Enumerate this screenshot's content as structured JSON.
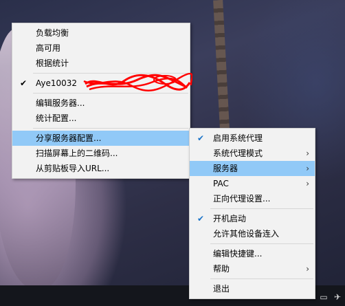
{
  "left_menu": {
    "items": [
      {
        "label": "负载均衡"
      },
      {
        "label": "高可用"
      },
      {
        "label": "根据统计"
      },
      {
        "label": "Aye10032",
        "checked": true,
        "redacted": true
      },
      {
        "label": "编辑服务器..."
      },
      {
        "label": "统计配置..."
      },
      {
        "label": "分享服务器配置...",
        "highlighted": true
      },
      {
        "label": "扫描屏幕上的二维码..."
      },
      {
        "label": "从剪贴板导入URL..."
      }
    ]
  },
  "tray_menu": {
    "items": [
      {
        "label": "启用系统代理",
        "checked": true
      },
      {
        "label": "系统代理模式",
        "submenu": true
      },
      {
        "label": "服务器",
        "submenu": true,
        "highlighted": true
      },
      {
        "label": "PAC",
        "submenu": true
      },
      {
        "label": "正向代理设置..."
      },
      {
        "label": "开机启动",
        "checked": true
      },
      {
        "label": "允许其他设备连入"
      },
      {
        "label": "编辑快捷键..."
      },
      {
        "label": "帮助",
        "submenu": true
      },
      {
        "label": "退出"
      }
    ]
  },
  "glyphs": {
    "check": "✔",
    "arrow": "›"
  },
  "colors": {
    "highlight": "#91c9f7",
    "menu_bg": "#f2f2f2",
    "redaction": "#ff0000"
  }
}
